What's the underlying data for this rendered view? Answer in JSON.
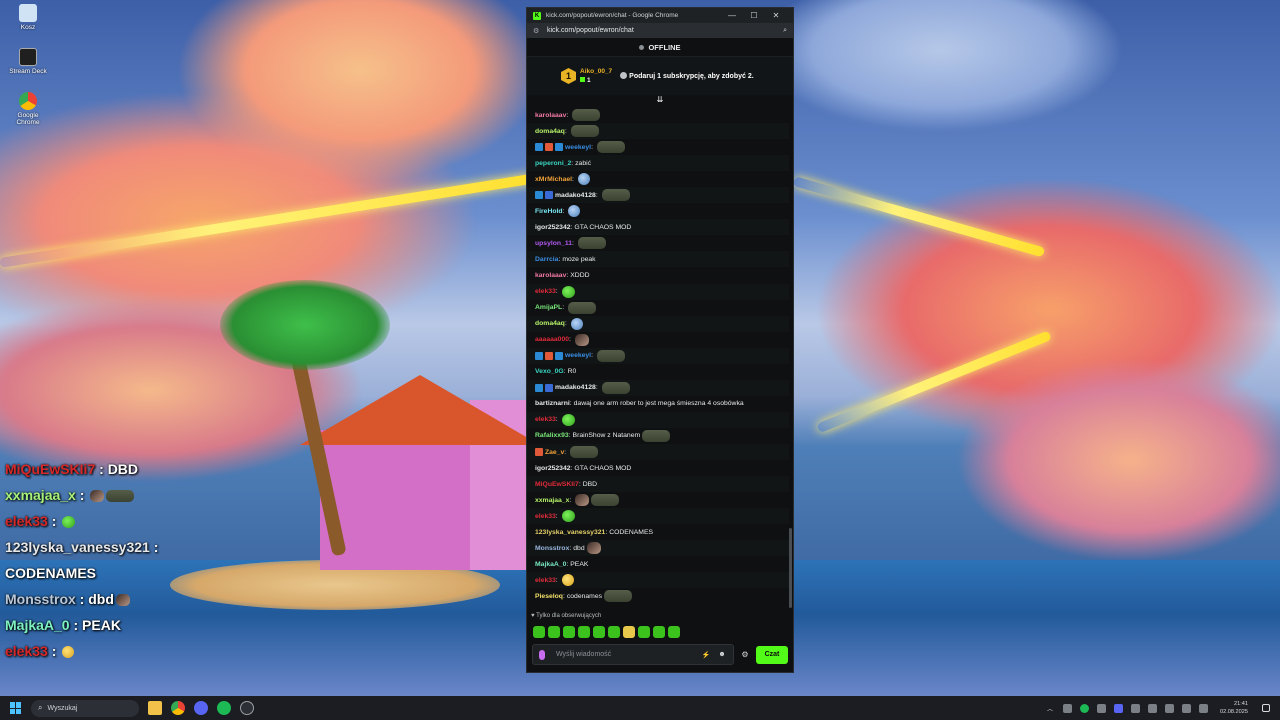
{
  "desktop": {
    "icons": [
      {
        "label": "Kosz",
        "icon": "recycle-bin-icon",
        "color": "#cfe3f5"
      },
      {
        "label": "Stream Deck",
        "icon": "stream-deck-icon",
        "color": "#1f1f1f"
      },
      {
        "label": "Google Chrome",
        "icon": "chrome-icon",
        "color": "#ea4335"
      }
    ]
  },
  "overlay_chat": [
    {
      "user": "MiQuEwSKIi7",
      "color": "#d62828",
      "text": "DBD",
      "emotes": []
    },
    {
      "user": "xxmajaa_x",
      "color": "#a6f27a",
      "text": "",
      "emotes": [
        "photo",
        "tank"
      ]
    },
    {
      "user": "elek33",
      "color": "#d62828",
      "text": "",
      "emotes": [
        "green"
      ]
    },
    {
      "user": "123lyska_vanessy321",
      "color": "#e6e8ea",
      "text": "",
      "emotes": []
    },
    {
      "user": "",
      "color": "#ffffff",
      "text": "CODENAMES",
      "emotes": []
    },
    {
      "user": "Monsstrox",
      "color": "#b9c7d8",
      "text": "dbd",
      "emotes": [
        "photo"
      ]
    },
    {
      "user": "MajkaA_0",
      "color": "#7ef2c0",
      "text": "PEAK",
      "emotes": []
    },
    {
      "user": "elek33",
      "color": "#d62828",
      "text": "",
      "emotes": [
        "yellow"
      ]
    }
  ],
  "browser": {
    "title": "kick.com/popout/ewron/chat - Google Chrome",
    "url": "kick.com/popout/ewron/chat",
    "controls": {
      "minimize": "—",
      "maximize": "☐",
      "close": "✕"
    }
  },
  "chat": {
    "status": "OFFLINE",
    "gift": {
      "rank": "1",
      "user": "Aiko_00_7",
      "count": "1",
      "text": "Podaruj 1 subskrypcję, aby zdobyć 2."
    },
    "messages": [
      {
        "user": "karolaaav",
        "color": "#f27aa4",
        "badges": [],
        "text": "",
        "emotes": [
          "tank"
        ]
      },
      {
        "user": "doma4aq",
        "color": "#b6f06a",
        "badges": [],
        "text": "",
        "emotes": [
          "tank"
        ]
      },
      {
        "user": "weekeyl",
        "color": "#3a8ee6",
        "badges": [
          "#2a8ad6",
          "#e05a3a",
          "#2a8ad6"
        ],
        "text": "",
        "emotes": [
          "tank"
        ]
      },
      {
        "user": "peperoni_2",
        "color": "#3ad6c2",
        "badges": [],
        "text": "zabić",
        "emotes": []
      },
      {
        "user": "xMrMichael",
        "color": "#f2a23a",
        "badges": [],
        "text": "",
        "emotes": [
          "face"
        ]
      },
      {
        "user": "madako4128",
        "color": "#e6e8ea",
        "badges": [
          "#2a8ad6",
          "#3a6ad6"
        ],
        "text": "",
        "emotes": [
          "tank"
        ]
      },
      {
        "user": "FireHold",
        "color": "#7ae6f2",
        "badges": [],
        "text": "",
        "emotes": [
          "face"
        ]
      },
      {
        "user": "igor252342",
        "color": "#e6e8ea",
        "badges": [],
        "text": "GTA CHAOS MOD",
        "emotes": []
      },
      {
        "user": "upsylon_11",
        "color": "#b45af2",
        "badges": [],
        "text": "",
        "emotes": [
          "tank"
        ]
      },
      {
        "user": "Darrcia",
        "color": "#3a8ee6",
        "badges": [],
        "text": "moze peak",
        "emotes": []
      },
      {
        "user": "karolaaav",
        "color": "#f27aa4",
        "badges": [],
        "text": "XDDD",
        "emotes": []
      },
      {
        "user": "elek33",
        "color": "#e02a3a",
        "badges": [],
        "text": "",
        "emotes": [
          "green"
        ]
      },
      {
        "user": "AmijaPL",
        "color": "#7ae67a",
        "badges": [],
        "text": "",
        "emotes": [
          "tank"
        ]
      },
      {
        "user": "doma4aq",
        "color": "#b6f06a",
        "badges": [],
        "text": "",
        "emotes": [
          "face"
        ]
      },
      {
        "user": "aaaaaa000",
        "color": "#e02a3a",
        "badges": [],
        "text": "",
        "emotes": [
          "photo"
        ]
      },
      {
        "user": "weekeyl",
        "color": "#3a8ee6",
        "badges": [
          "#2a8ad6",
          "#e05a3a",
          "#2a8ad6"
        ],
        "text": "",
        "emotes": [
          "tank"
        ]
      },
      {
        "user": "Vexo_0G",
        "color": "#3ad6c2",
        "badges": [],
        "text": "R0",
        "emotes": []
      },
      {
        "user": "madako4128",
        "color": "#e6e8ea",
        "badges": [
          "#2a8ad6",
          "#3a6ad6"
        ],
        "text": "",
        "emotes": [
          "tank"
        ]
      },
      {
        "user": "bartiznarni",
        "color": "#e6e8ea",
        "badges": [],
        "text": "dawaj one arm rober to jest mega śmieszna 4 osobówka",
        "emotes": []
      },
      {
        "user": "elek33",
        "color": "#e02a3a",
        "badges": [],
        "text": "",
        "emotes": [
          "green"
        ]
      },
      {
        "user": "Rafalixx93",
        "color": "#7ae67a",
        "badges": [],
        "text": "BrainShow z Natanem",
        "emotes": [
          "tank"
        ]
      },
      {
        "user": "Zae_v",
        "color": "#f2a23a",
        "badges": [
          "#e05a3a"
        ],
        "text": "",
        "emotes": [
          "tank"
        ]
      },
      {
        "user": "igor252342",
        "color": "#e6e8ea",
        "badges": [],
        "text": "GTA CHAOS MOD",
        "emotes": []
      },
      {
        "user": "MiQuEwSKIi7",
        "color": "#e02a3a",
        "badges": [],
        "text": "DBD",
        "emotes": []
      },
      {
        "user": "xxmajaa_x",
        "color": "#b6f06a",
        "badges": [],
        "text": "",
        "emotes": [
          "photo",
          "tank"
        ]
      },
      {
        "user": "elek33",
        "color": "#e02a3a",
        "badges": [],
        "text": "",
        "emotes": [
          "green"
        ]
      },
      {
        "user": "123lyska_vanessy321",
        "color": "#e6d06a",
        "badges": [],
        "text": "CODENAMES",
        "emotes": []
      },
      {
        "user": "Monsstrox",
        "color": "#9ab8e0",
        "badges": [],
        "text": "dbd",
        "emotes": [
          "photo"
        ]
      },
      {
        "user": "MajkaA_0",
        "color": "#7ae6c0",
        "badges": [],
        "text": "PEAK",
        "emotes": []
      },
      {
        "user": "elek33",
        "color": "#e02a3a",
        "badges": [],
        "text": "",
        "emotes": [
          "yellow"
        ]
      },
      {
        "user": "Pieseloq",
        "color": "#f2e06a",
        "badges": [],
        "text": "codenames",
        "emotes": [
          "tank"
        ]
      }
    ],
    "followers_only": "Tylko dla obserwujących",
    "input_placeholder": "Wyślij wiadomość",
    "send_label": "Czat",
    "accent": "#53fc18"
  },
  "taskbar": {
    "search_placeholder": "Wyszukaj",
    "time": "21:41",
    "date": "02.08.2025",
    "apps": [
      {
        "name": "file-explorer-icon",
        "color": "#f2c14a"
      },
      {
        "name": "chrome-icon",
        "color": "#ea4335"
      },
      {
        "name": "discord-icon",
        "color": "#5865f2"
      },
      {
        "name": "spotify-icon",
        "color": "#1db954"
      },
      {
        "name": "app-icon",
        "color": "#9aa0a6"
      }
    ]
  }
}
